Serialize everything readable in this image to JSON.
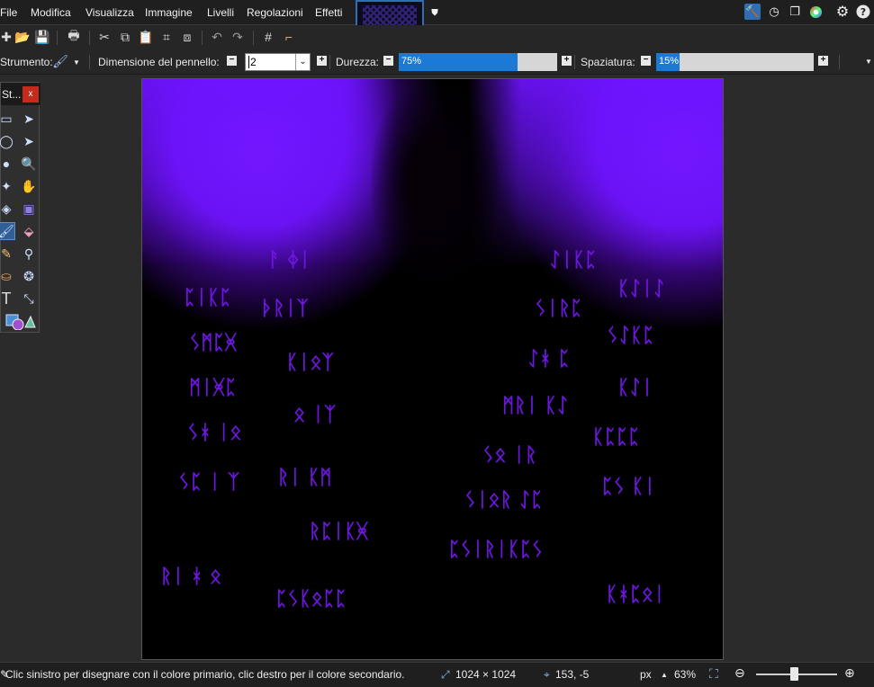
{
  "menubar": {
    "items": [
      "File",
      "Modifica",
      "Visualizza",
      "Immagine",
      "Livelli",
      "Regolazioni",
      "Effetti"
    ],
    "icons": [
      "hammer-icon",
      "clock-history-icon",
      "layers-icon",
      "color-wheel-icon",
      "gear-icon",
      "help-icon"
    ]
  },
  "options": {
    "tool_label": "Strumento:",
    "brush_size_label": "Dimensione del pennello:",
    "brush_size_value": "2",
    "hardness_label": "Durezza:",
    "hardness_value": "75%",
    "hardness_fraction": 0.75,
    "spacing_label": "Spaziatura:",
    "spacing_value": "15%",
    "spacing_fraction": 0.15
  },
  "tools": {
    "title": "St...",
    "close": "x",
    "selected": "paintbrush"
  },
  "canvas": {
    "colors": {
      "glow": "#7a1cff",
      "rune": "#6d16e0",
      "background": "#000000"
    }
  },
  "status": {
    "hint": "Clic sinistro per disegnare con il colore primario, clic destro per il colore secondario.",
    "image_size": "1024 × 1024",
    "cursor_pos": "153, -5",
    "unit": "px",
    "zoom": "63%"
  }
}
